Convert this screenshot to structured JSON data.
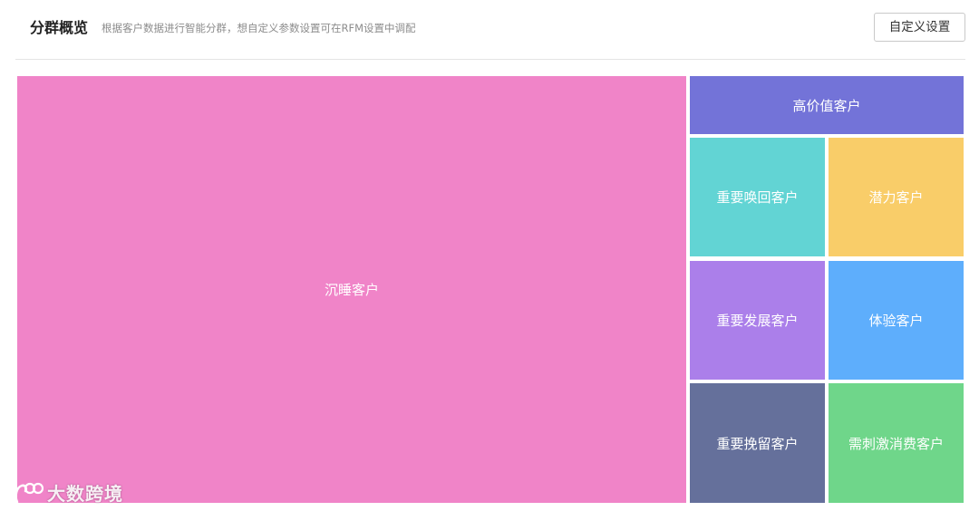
{
  "header": {
    "title": "分群概览",
    "subtitle": "根据客户数据进行智能分群，想自定义参数设置可在RFM设置中调配",
    "custom_button_label": "自定义设置"
  },
  "segments": [
    {
      "key": "dormant",
      "label": "沉睡客户",
      "color": "#f084c8"
    },
    {
      "key": "high_value",
      "label": "高价值客户",
      "color": "#7373d8"
    },
    {
      "key": "recall",
      "label": "重要唤回客户",
      "color": "#62d4d4"
    },
    {
      "key": "potential",
      "label": "潜力客户",
      "color": "#f9cd69"
    },
    {
      "key": "develop",
      "label": "重要发展客户",
      "color": "#ab7fea"
    },
    {
      "key": "trial",
      "label": "体验客户",
      "color": "#5eaefc"
    },
    {
      "key": "retain",
      "label": "重要挽留客户",
      "color": "#65709b"
    },
    {
      "key": "stimulate",
      "label": "需刺激消费客户",
      "color": "#6fd68a"
    }
  ],
  "watermark": {
    "text": "大数跨境"
  }
}
